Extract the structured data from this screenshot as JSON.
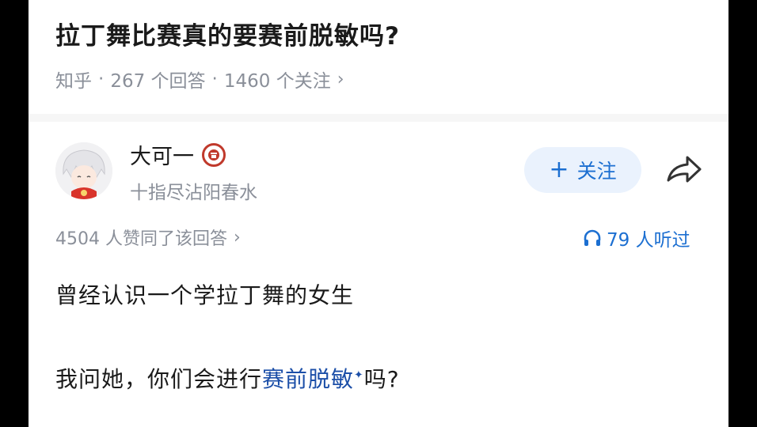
{
  "question": {
    "title": "拉丁舞比赛真的要赛前脱敏吗?",
    "source": "知乎",
    "answers": "267 个回答",
    "followers": "1460 个关注",
    "sep": "·"
  },
  "author": {
    "name": "大可一",
    "bio": "十指尽沾阳春水",
    "follow_label": "关注"
  },
  "answer": {
    "likes": "4504 人赞同了该回答",
    "listens": "79 人听过",
    "para1": "曾经认识一个学拉丁舞的女生",
    "para2_prefix": "我问她，你们会进行",
    "para2_link": "赛前脱敏",
    "para2_suffix": "吗?"
  },
  "colors": {
    "accent": "#1c6fd1",
    "follow_bg": "#eaf2fd",
    "meta_gray": "#8a8f99",
    "link": "#1c4fa8",
    "badge": "#c0392b"
  },
  "icons": {
    "chevron": "chevron-right-icon",
    "share": "share-arrow-icon",
    "headphones": "headphones-icon",
    "badge": "verified-badge-icon"
  }
}
